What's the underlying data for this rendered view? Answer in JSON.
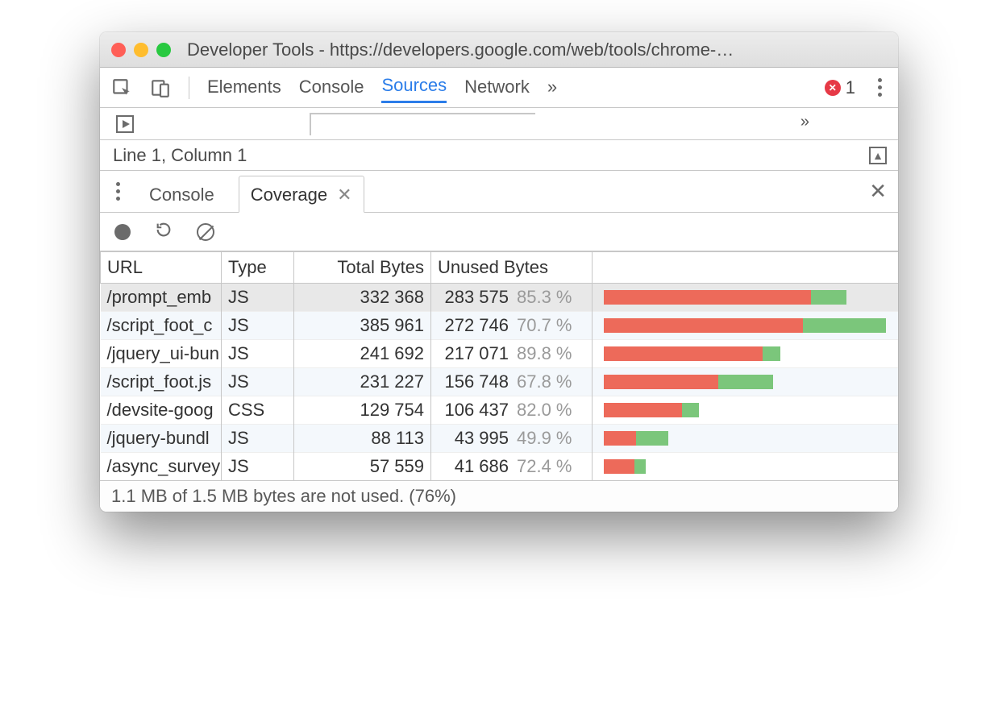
{
  "window": {
    "title": "Developer Tools - https://developers.google.com/web/tools/chrome-…"
  },
  "main_tabs": [
    "Elements",
    "Console",
    "Sources",
    "Network"
  ],
  "main_tabs_overflow": "»",
  "main_tabs_active": "Sources",
  "error_count": "1",
  "line_col": "Line 1, Column 1",
  "drawer_tabs": {
    "console": "Console",
    "coverage": "Coverage"
  },
  "coverage": {
    "headers": {
      "url": "URL",
      "type": "Type",
      "total": "Total Bytes",
      "unused": "Unused Bytes"
    },
    "max_total": 385961,
    "rows": [
      {
        "url": "/prompt_emb",
        "type": "JS",
        "total": "332 368",
        "unused": "283 575",
        "pct": "85.3 %",
        "selected": true,
        "total_n": 332368,
        "unused_n": 283575
      },
      {
        "url": "/script_foot_c",
        "type": "JS",
        "total": "385 961",
        "unused": "272 746",
        "pct": "70.7 %",
        "selected": false,
        "total_n": 385961,
        "unused_n": 272746
      },
      {
        "url": "/jquery_ui-bun",
        "type": "JS",
        "total": "241 692",
        "unused": "217 071",
        "pct": "89.8 %",
        "selected": false,
        "total_n": 241692,
        "unused_n": 217071
      },
      {
        "url": "/script_foot.js",
        "type": "JS",
        "total": "231 227",
        "unused": "156 748",
        "pct": "67.8 %",
        "selected": false,
        "total_n": 231227,
        "unused_n": 156748
      },
      {
        "url": "/devsite-goog",
        "type": "CSS",
        "total": "129 754",
        "unused": "106 437",
        "pct": "82.0 %",
        "selected": false,
        "total_n": 129754,
        "unused_n": 106437
      },
      {
        "url": "/jquery-bundl",
        "type": "JS",
        "total": "88 113",
        "unused": "43 995",
        "pct": "49.9 %",
        "selected": false,
        "total_n": 88113,
        "unused_n": 43995
      },
      {
        "url": "/async_survey",
        "type": "JS",
        "total": "57 559",
        "unused": "41 686",
        "pct": "72.4 %",
        "selected": false,
        "total_n": 57559,
        "unused_n": 41686
      }
    ]
  },
  "footer": "1.1 MB of 1.5 MB bytes are not used. (76%)"
}
